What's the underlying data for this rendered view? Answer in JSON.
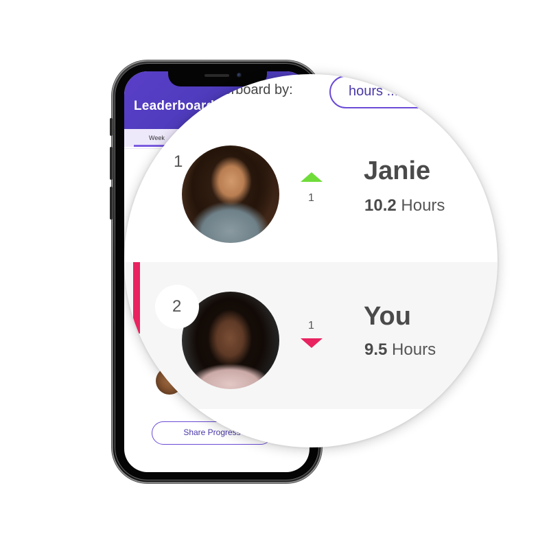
{
  "app": {
    "title": "Leaderboard",
    "active_tab": "Week"
  },
  "screen": {
    "share_button_label": "Share Progress"
  },
  "magnifier": {
    "sort_label": "Leaderboard by:",
    "sort_value": "hours ..."
  },
  "entries": [
    {
      "rank": "1",
      "name": "Janie",
      "hours_value": "10.2",
      "hours_unit": "Hours",
      "trend": "up",
      "trend_change": "1",
      "highlighted": false
    },
    {
      "rank": "2",
      "name": "You",
      "hours_value": "9.5",
      "hours_unit": "Hours",
      "trend": "down",
      "trend_change": "1",
      "highlighted": true
    }
  ],
  "colors": {
    "brand_purple": "#5a3fc8",
    "accent_pink": "#e8235f",
    "trend_up": "#6fdc3a",
    "trend_down": "#e8235f"
  },
  "icons": {
    "trend_up": "triangle-up-icon",
    "trend_down": "triangle-down-icon",
    "dropdown": "chevron-down-icon"
  }
}
